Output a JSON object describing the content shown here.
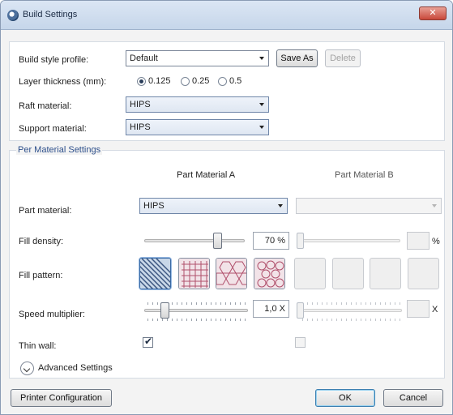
{
  "window": {
    "title": "Build Settings",
    "close_label": "✕"
  },
  "build": {
    "profile_label": "Build style profile:",
    "profile_value": "Default",
    "save_as_label": "Save As",
    "delete_label": "Delete",
    "layer_label": "Layer thickness (mm):",
    "layer_options": [
      "0.125",
      "0.25",
      "0.5"
    ],
    "layer_selected": "0.125",
    "raft_label": "Raft material:",
    "raft_value": "HIPS",
    "support_label": "Support material:",
    "support_value": "HIPS"
  },
  "per_material": {
    "group_title": "Per Material Settings",
    "col_a": "Part Material A",
    "col_b": "Part Material B",
    "part_material_label": "Part material:",
    "part_material_a": "HIPS",
    "part_material_b": "",
    "fill_density_label": "Fill density:",
    "fill_density_a": "70",
    "fill_density_b": "",
    "percent_unit": "%",
    "fill_pattern_label": "Fill pattern:",
    "patterns": [
      "diagonal-lines",
      "grid",
      "hexagon",
      "circles"
    ],
    "speed_label": "Speed multiplier:",
    "speed_a": "1,0",
    "speed_b": "",
    "x_unit": "X",
    "thin_wall_label": "Thin wall:",
    "thin_wall_a": true,
    "thin_wall_b": false
  },
  "advanced_label": "Advanced Settings",
  "footer": {
    "printer_config_label": "Printer Configuration",
    "ok_label": "OK",
    "cancel_label": "Cancel"
  },
  "colors": {
    "group_title": "#2d4f8b",
    "pattern_selected": "#3a6aa4"
  },
  "icons": [
    "app-icon",
    "close-icon",
    "dropdown-arrow-icon",
    "expand-chevron-icon",
    "checkmark-icon"
  ]
}
